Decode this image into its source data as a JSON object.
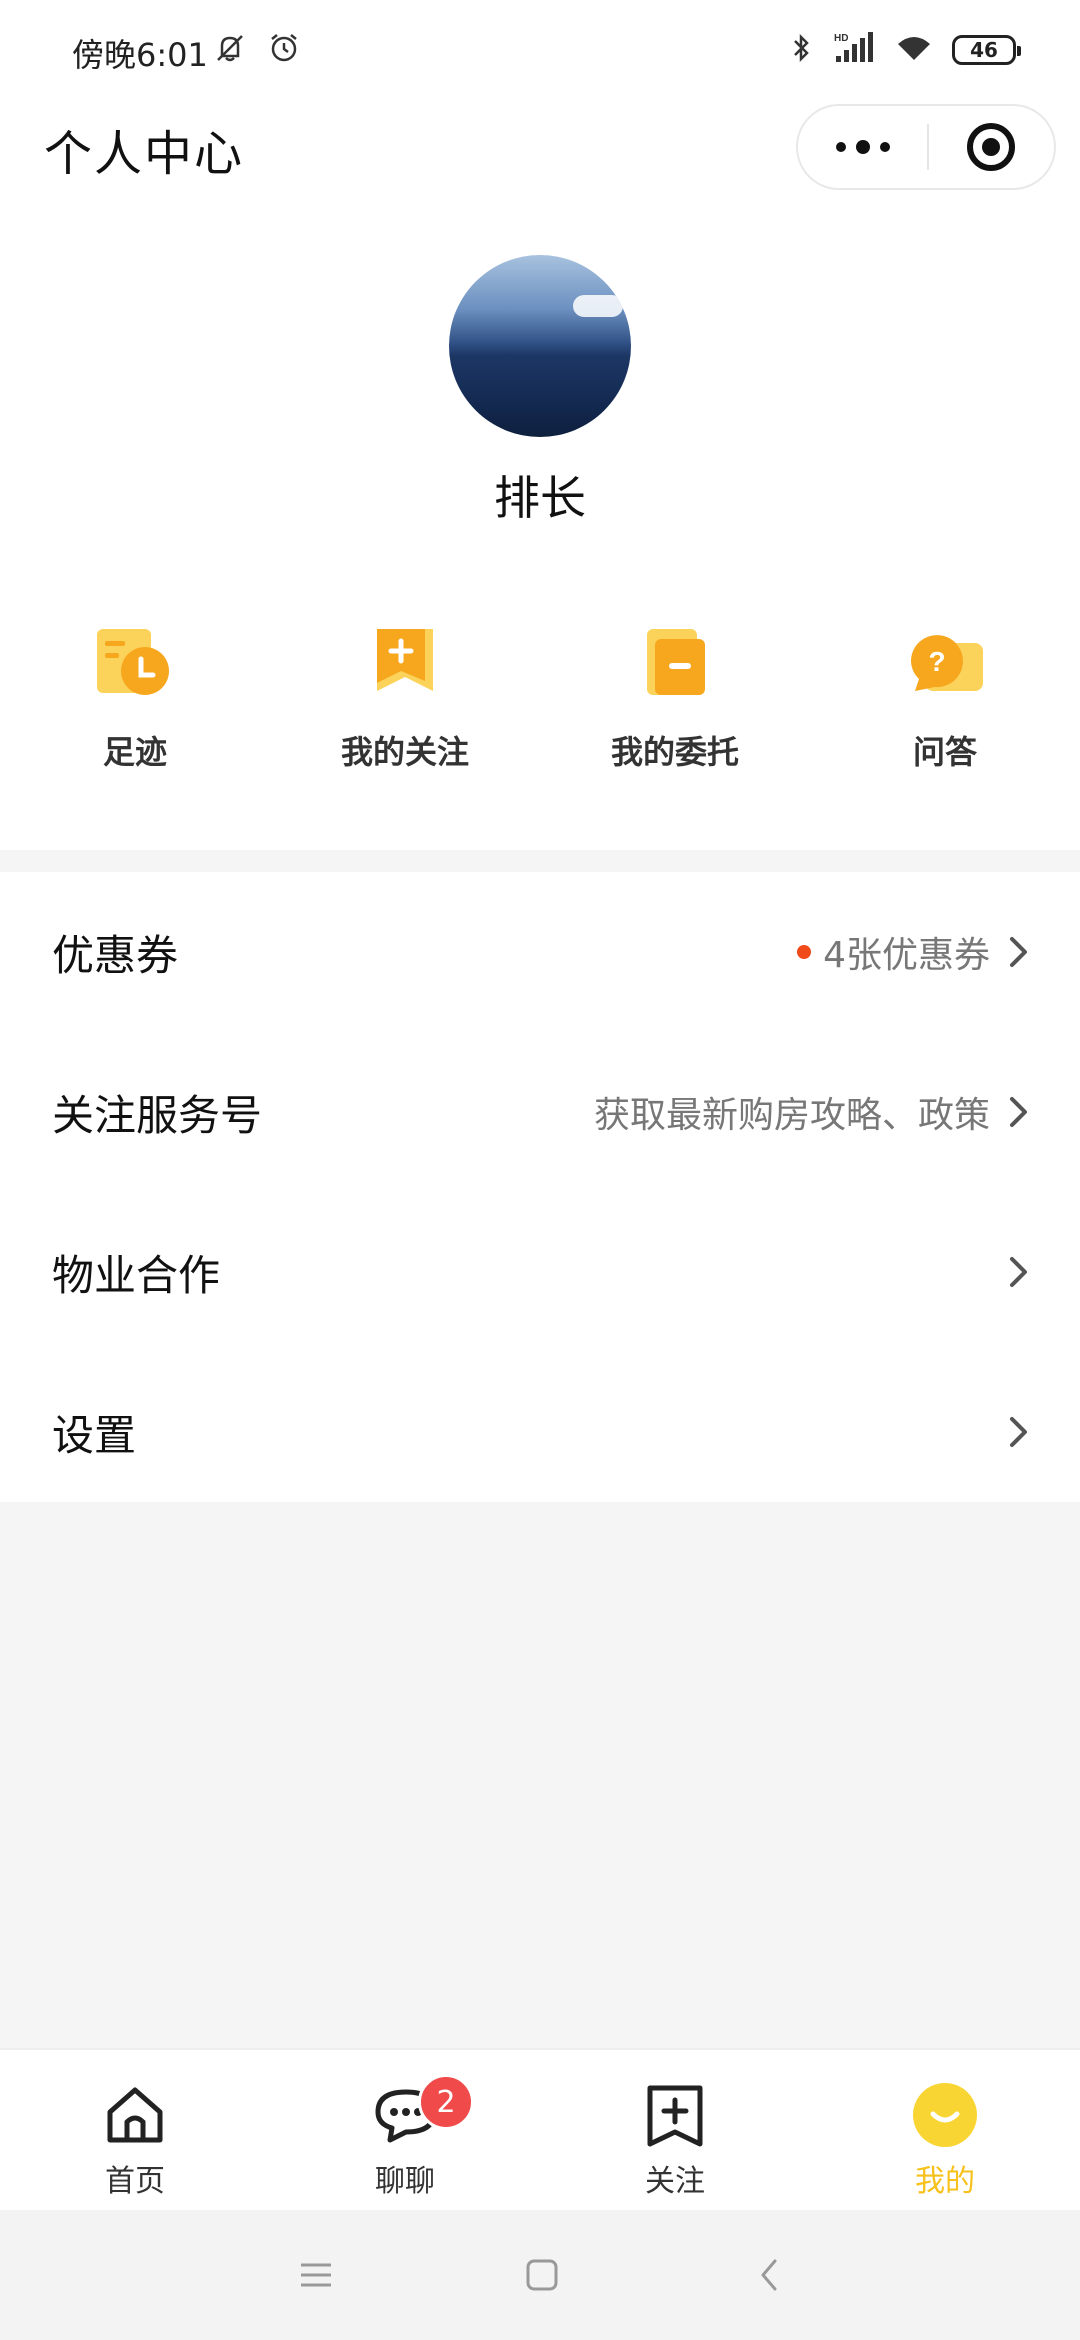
{
  "status_bar": {
    "time": "傍晚6:01",
    "battery": "46"
  },
  "header": {
    "title": "个人中心"
  },
  "profile": {
    "username": "排长"
  },
  "quick_actions": [
    {
      "label": "足迹",
      "icon": "footprint-icon"
    },
    {
      "label": "我的关注",
      "icon": "follow-icon"
    },
    {
      "label": "我的委托",
      "icon": "entrust-icon"
    },
    {
      "label": "问答",
      "icon": "qa-icon"
    }
  ],
  "menu": [
    {
      "label": "优惠券",
      "detail": "4张优惠券",
      "has_dot": true
    },
    {
      "label": "关注服务号",
      "detail": "获取最新购房攻略、政策",
      "has_dot": false
    },
    {
      "label": "物业合作",
      "detail": "",
      "has_dot": false
    },
    {
      "label": "设置",
      "detail": "",
      "has_dot": false
    }
  ],
  "tabbar": {
    "tabs": [
      {
        "label": "首页",
        "icon": "home-icon"
      },
      {
        "label": "聊聊",
        "icon": "chat-icon",
        "badge": "2"
      },
      {
        "label": "关注",
        "icon": "follow-tab-icon"
      },
      {
        "label": "我的",
        "icon": "mine-icon",
        "active": true
      }
    ]
  },
  "colors": {
    "accent": "#f6c11a",
    "icon_yellow": "#fcd35a",
    "icon_orange": "#f7a71e",
    "badge_red": "#f04a4a"
  }
}
